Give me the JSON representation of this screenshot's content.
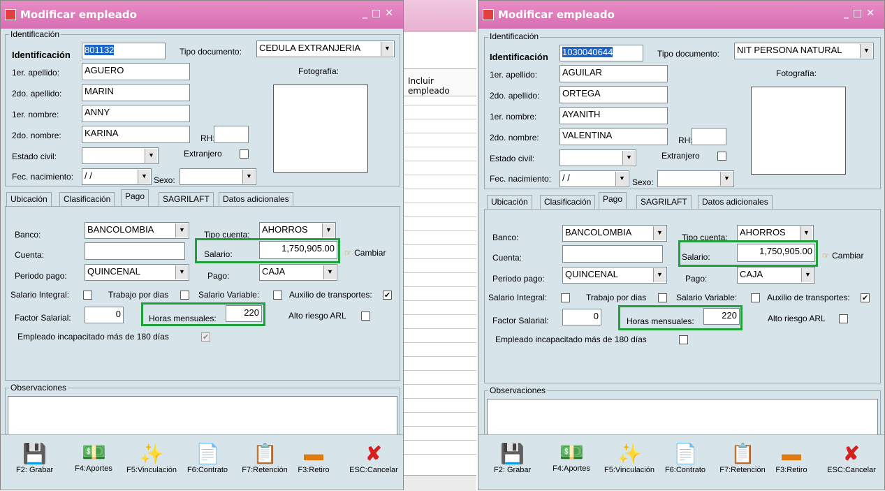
{
  "background_list": {
    "header": "Incluir empleado"
  },
  "windows": [
    {
      "title": "Modificar empleado",
      "identificacion_group": "Identificación",
      "id_label": "Identificación",
      "id_value": "801132",
      "tipo_doc_label": "Tipo documento:",
      "tipo_doc_value": "CEDULA EXTRANJERIA",
      "apellido1_label": "1er. apellido:",
      "apellido1": "AGUERO",
      "apellido2_label": "2do. apellido:",
      "apellido2": "MARIN",
      "nombre1_label": "1er. nombre:",
      "nombre1": "ANNY",
      "nombre2_label": "2do. nombre:",
      "nombre2": "KARINA",
      "rh_label": "RH:",
      "estado_civil_label": "Estado civil:",
      "extranjero_label": "Extranjero",
      "fec_nac_label": "Fec. nacimiento:",
      "fec_nac_value": " /  /",
      "sexo_label": "Sexo:",
      "foto_label": "Fotografía:",
      "tabs": [
        "Ubicación",
        "Clasificación",
        "Pago",
        "SAGRILAFT",
        "Datos adicionales"
      ],
      "banco_label": "Banco:",
      "banco": "BANCOLOMBIA",
      "tipo_cuenta_label": "Tipo cuenta:",
      "tipo_cuenta": "AHORROS",
      "cuenta_label": "Cuenta:",
      "salario_label": "Salario:",
      "salario": "1,750,905.00",
      "cambiar_label": "Cambiar",
      "periodo_label": "Periodo pago:",
      "periodo": "QUINCENAL",
      "pago_label": "Pago:",
      "pago": "CAJA",
      "salario_integral_label": "Salario Integral:",
      "trabajo_dias_label": "Trabajo por dias",
      "salario_variable_label": "Salario Variable:",
      "auxilio_label": "Auxilio de transportes:",
      "factor_label": "Factor Salarial:",
      "factor": "0",
      "horas_label": "Horas mensuales:",
      "horas": "220",
      "alto_riesgo_label": "Alto riesgo ARL",
      "incapacitado_label": "Empleado incapacitado más de 180 días",
      "observaciones_label": "Observaciones",
      "toolbar": [
        "F2: Grabar",
        "F4:Aportes",
        "F5:Vinculación",
        "F6:Contrato",
        "F7:Retención",
        "F3:Retiro",
        "ESC:Cancelar"
      ]
    },
    {
      "title": "Modificar empleado",
      "identificacion_group": "Identificación",
      "id_label": "Identificación",
      "id_value": "1030040644",
      "tipo_doc_label": "Tipo documento:",
      "tipo_doc_value": "NIT PERSONA NATURAL",
      "apellido1_label": "1er. apellido:",
      "apellido1": "AGUILAR",
      "apellido2_label": "2do. apellido:",
      "apellido2": "ORTEGA",
      "nombre1_label": "1er. nombre:",
      "nombre1": "AYANITH",
      "nombre2_label": "2do. nombre:",
      "nombre2": "VALENTINA",
      "rh_label": "RH:",
      "estado_civil_label": "Estado civil:",
      "extranjero_label": "Extranjero",
      "fec_nac_label": "Fec. nacimiento:",
      "fec_nac_value": " /  /",
      "sexo_label": "Sexo:",
      "foto_label": "Fotografía:",
      "tabs": [
        "Ubicación",
        "Clasificación",
        "Pago",
        "SAGRILAFT",
        "Datos adicionales"
      ],
      "banco_label": "Banco:",
      "banco": "BANCOLOMBIA",
      "tipo_cuenta_label": "Tipo cuenta:",
      "tipo_cuenta": "AHORROS",
      "cuenta_label": "Cuenta:",
      "salario_label": "Salario:",
      "salario": "1,750,905.00",
      "cambiar_label": "Cambiar",
      "periodo_label": "Periodo pago:",
      "periodo": "QUINCENAL",
      "pago_label": "Pago:",
      "pago": "CAJA",
      "salario_integral_label": "Salario Integral:",
      "trabajo_dias_label": "Trabajo por dias",
      "salario_variable_label": "Salario Variable:",
      "auxilio_label": "Auxilio de transportes:",
      "factor_label": "Factor Salarial:",
      "factor": "0",
      "horas_label": "Horas mensuales:",
      "horas": "220",
      "alto_riesgo_label": "Alto riesgo ARL",
      "incapacitado_label": "Empleado incapacitado más de 180 días",
      "observaciones_label": "Observaciones",
      "toolbar": [
        "F2: Grabar",
        "F4:Aportes",
        "F5:Vinculación",
        "F6:Contrato",
        "F7:Retención",
        "F3:Retiro",
        "ESC:Cancelar"
      ]
    }
  ]
}
